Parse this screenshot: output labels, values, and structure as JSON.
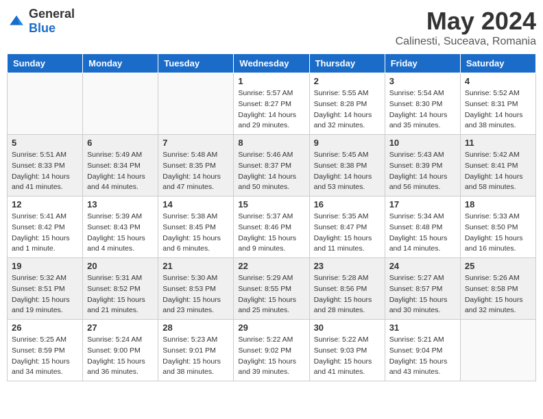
{
  "header": {
    "logo_general": "General",
    "logo_blue": "Blue",
    "month_year": "May 2024",
    "location": "Calinesti, Suceava, Romania"
  },
  "days_of_week": [
    "Sunday",
    "Monday",
    "Tuesday",
    "Wednesday",
    "Thursday",
    "Friday",
    "Saturday"
  ],
  "weeks": [
    {
      "days": [
        {
          "number": "",
          "info": ""
        },
        {
          "number": "",
          "info": ""
        },
        {
          "number": "",
          "info": ""
        },
        {
          "number": "1",
          "info": "Sunrise: 5:57 AM\nSunset: 8:27 PM\nDaylight: 14 hours\nand 29 minutes."
        },
        {
          "number": "2",
          "info": "Sunrise: 5:55 AM\nSunset: 8:28 PM\nDaylight: 14 hours\nand 32 minutes."
        },
        {
          "number": "3",
          "info": "Sunrise: 5:54 AM\nSunset: 8:30 PM\nDaylight: 14 hours\nand 35 minutes."
        },
        {
          "number": "4",
          "info": "Sunrise: 5:52 AM\nSunset: 8:31 PM\nDaylight: 14 hours\nand 38 minutes."
        }
      ]
    },
    {
      "days": [
        {
          "number": "5",
          "info": "Sunrise: 5:51 AM\nSunset: 8:33 PM\nDaylight: 14 hours\nand 41 minutes."
        },
        {
          "number": "6",
          "info": "Sunrise: 5:49 AM\nSunset: 8:34 PM\nDaylight: 14 hours\nand 44 minutes."
        },
        {
          "number": "7",
          "info": "Sunrise: 5:48 AM\nSunset: 8:35 PM\nDaylight: 14 hours\nand 47 minutes."
        },
        {
          "number": "8",
          "info": "Sunrise: 5:46 AM\nSunset: 8:37 PM\nDaylight: 14 hours\nand 50 minutes."
        },
        {
          "number": "9",
          "info": "Sunrise: 5:45 AM\nSunset: 8:38 PM\nDaylight: 14 hours\nand 53 minutes."
        },
        {
          "number": "10",
          "info": "Sunrise: 5:43 AM\nSunset: 8:39 PM\nDaylight: 14 hours\nand 56 minutes."
        },
        {
          "number": "11",
          "info": "Sunrise: 5:42 AM\nSunset: 8:41 PM\nDaylight: 14 hours\nand 58 minutes."
        }
      ]
    },
    {
      "days": [
        {
          "number": "12",
          "info": "Sunrise: 5:41 AM\nSunset: 8:42 PM\nDaylight: 15 hours\nand 1 minute."
        },
        {
          "number": "13",
          "info": "Sunrise: 5:39 AM\nSunset: 8:43 PM\nDaylight: 15 hours\nand 4 minutes."
        },
        {
          "number": "14",
          "info": "Sunrise: 5:38 AM\nSunset: 8:45 PM\nDaylight: 15 hours\nand 6 minutes."
        },
        {
          "number": "15",
          "info": "Sunrise: 5:37 AM\nSunset: 8:46 PM\nDaylight: 15 hours\nand 9 minutes."
        },
        {
          "number": "16",
          "info": "Sunrise: 5:35 AM\nSunset: 8:47 PM\nDaylight: 15 hours\nand 11 minutes."
        },
        {
          "number": "17",
          "info": "Sunrise: 5:34 AM\nSunset: 8:48 PM\nDaylight: 15 hours\nand 14 minutes."
        },
        {
          "number": "18",
          "info": "Sunrise: 5:33 AM\nSunset: 8:50 PM\nDaylight: 15 hours\nand 16 minutes."
        }
      ]
    },
    {
      "days": [
        {
          "number": "19",
          "info": "Sunrise: 5:32 AM\nSunset: 8:51 PM\nDaylight: 15 hours\nand 19 minutes."
        },
        {
          "number": "20",
          "info": "Sunrise: 5:31 AM\nSunset: 8:52 PM\nDaylight: 15 hours\nand 21 minutes."
        },
        {
          "number": "21",
          "info": "Sunrise: 5:30 AM\nSunset: 8:53 PM\nDaylight: 15 hours\nand 23 minutes."
        },
        {
          "number": "22",
          "info": "Sunrise: 5:29 AM\nSunset: 8:55 PM\nDaylight: 15 hours\nand 25 minutes."
        },
        {
          "number": "23",
          "info": "Sunrise: 5:28 AM\nSunset: 8:56 PM\nDaylight: 15 hours\nand 28 minutes."
        },
        {
          "number": "24",
          "info": "Sunrise: 5:27 AM\nSunset: 8:57 PM\nDaylight: 15 hours\nand 30 minutes."
        },
        {
          "number": "25",
          "info": "Sunrise: 5:26 AM\nSunset: 8:58 PM\nDaylight: 15 hours\nand 32 minutes."
        }
      ]
    },
    {
      "days": [
        {
          "number": "26",
          "info": "Sunrise: 5:25 AM\nSunset: 8:59 PM\nDaylight: 15 hours\nand 34 minutes."
        },
        {
          "number": "27",
          "info": "Sunrise: 5:24 AM\nSunset: 9:00 PM\nDaylight: 15 hours\nand 36 minutes."
        },
        {
          "number": "28",
          "info": "Sunrise: 5:23 AM\nSunset: 9:01 PM\nDaylight: 15 hours\nand 38 minutes."
        },
        {
          "number": "29",
          "info": "Sunrise: 5:22 AM\nSunset: 9:02 PM\nDaylight: 15 hours\nand 39 minutes."
        },
        {
          "number": "30",
          "info": "Sunrise: 5:22 AM\nSunset: 9:03 PM\nDaylight: 15 hours\nand 41 minutes."
        },
        {
          "number": "31",
          "info": "Sunrise: 5:21 AM\nSunset: 9:04 PM\nDaylight: 15 hours\nand 43 minutes."
        },
        {
          "number": "",
          "info": ""
        }
      ]
    }
  ]
}
